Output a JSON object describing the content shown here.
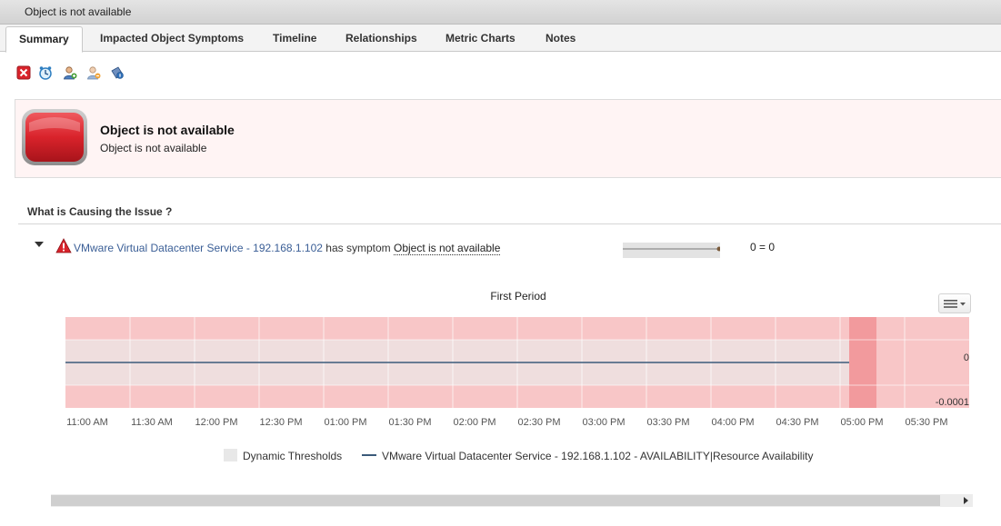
{
  "window": {
    "title": "Object is not available"
  },
  "tabs": [
    {
      "label": "Summary"
    },
    {
      "label": "Impacted Object Symptoms"
    },
    {
      "label": "Timeline"
    },
    {
      "label": "Relationships"
    },
    {
      "label": "Metric Charts"
    },
    {
      "label": "Notes"
    }
  ],
  "toolbar": {
    "icons": [
      "cancel-alert-icon",
      "suspend-icon",
      "take-ownership-icon",
      "release-ownership-icon",
      "action-icon"
    ]
  },
  "alert": {
    "title": "Object is not available",
    "subtitle": "Object is not available",
    "color": "#d9232b"
  },
  "cause": {
    "section_title": "What is Causing the Issue ?",
    "object_link": "VMware Virtual Datacenter Service - 192.168.1.102",
    "has_symptom": "has symptom",
    "symptom_link": "Object is not available",
    "equation": "0 = 0"
  },
  "chart_data": {
    "type": "line",
    "title": "First Period",
    "x": [
      "11:00 AM",
      "11:30 AM",
      "12:00 PM",
      "12:30 PM",
      "01:00 PM",
      "01:30 PM",
      "02:00 PM",
      "02:30 PM",
      "03:00 PM",
      "03:30 PM",
      "04:00 PM",
      "04:30 PM",
      "05:00 PM",
      "05:30 PM"
    ],
    "y_ticks": [
      "0",
      "-0.0001"
    ],
    "series": [
      {
        "name": "VMware Virtual Datacenter Service - 192.168.1.102 - AVAILABILITY|Resource Availability",
        "color": "#3b5a7a",
        "values": [
          0,
          0,
          0,
          0,
          0,
          0,
          0,
          0,
          0,
          0,
          0,
          0,
          0
        ]
      }
    ],
    "legend": [
      "Dynamic Thresholds",
      "VMware Virtual Datacenter Service - 192.168.1.102 - AVAILABILITY|Resource Availability"
    ],
    "legend_placement": "bottom",
    "grid": true,
    "colors": {
      "alert_band": "#f8c6c7",
      "threshold_band": "#efdede",
      "alert_marker": "#f29a9d"
    }
  }
}
